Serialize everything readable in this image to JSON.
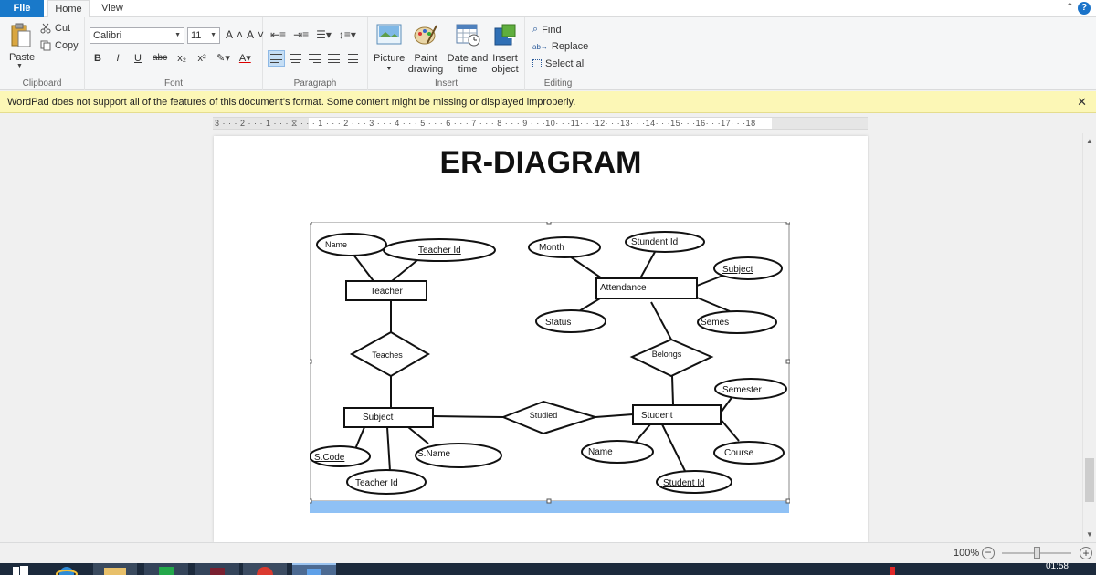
{
  "tabs": [
    {
      "label": "File"
    },
    {
      "label": "Home"
    },
    {
      "label": "View"
    }
  ],
  "ribbon": {
    "clipboard": {
      "label": "Clipboard",
      "paste": "Paste",
      "cut": "Cut",
      "copy": "Copy"
    },
    "font": {
      "label": "Font",
      "name": "Calibri",
      "size": "11"
    },
    "paragraph": {
      "label": "Paragraph"
    },
    "insert": {
      "label": "Insert",
      "picture": "Picture",
      "paint_line1": "Paint",
      "paint_line2": "drawing",
      "date_line1": "Date and",
      "date_line2": "time",
      "object_line1": "Insert",
      "object_line2": "object"
    },
    "editing": {
      "label": "Editing",
      "find": "Find",
      "replace": "Replace",
      "select_all": "Select all"
    }
  },
  "message": "WordPad does not support all of the features of this document's format. Some content might be missing or displayed improperly.",
  "ruler": "3 · · · 2 · · · 1 · · · ⧖ · · · 1 · · · 2 · · · 3 · · · 4 · · · 5 · · · 6 · · · 7 · · · 8 · · · 9 · · ·10· · ·11· · ·12· · ·13· · ·14· · ·15· · ·16· · ·17· · ·18",
  "document": {
    "title": "ER-DIAGRAM",
    "diagram": {
      "entities": {
        "teacher": "Teacher",
        "attendance": "Attendance",
        "subject": "Subject",
        "student": "Student"
      },
      "relationships": {
        "teaches": "Teaches",
        "belongs": "Belongs",
        "studied": "Studied"
      },
      "attributes": {
        "teacher_name": "Name",
        "teacher_id": "Teacher Id",
        "month": "Month",
        "attendance_student_id": "Stundent Id",
        "attendance_subject": "Subject",
        "status": "Status",
        "semes": "Semes",
        "semester": "Semester",
        "s_code": "S.Code",
        "s_name": "S.Name",
        "subject_teacher_id": "Teacher Id",
        "student_name": "Name",
        "course": "Course",
        "student_id": "Student Id"
      }
    }
  },
  "status": {
    "zoom": "100%"
  },
  "taskbar": {
    "time": "01:58"
  },
  "colors": {
    "file_tab": "#1979ca",
    "message_bg": "#fcf7b6",
    "selection_bar": "#8fc1f5"
  }
}
